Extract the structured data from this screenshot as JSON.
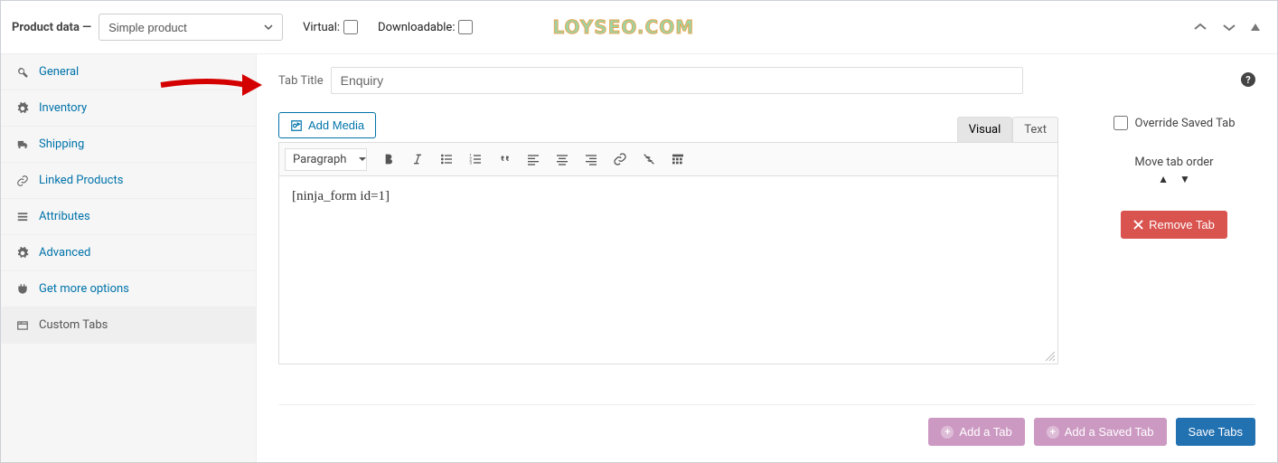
{
  "header": {
    "title": "Product data —",
    "product_type": "Simple product",
    "virtual_label": "Virtual:",
    "downloadable_label": "Downloadable:",
    "watermark": "LOYSEO.COM"
  },
  "sidebar": {
    "items": [
      {
        "icon": "wrench-icon",
        "label": "General"
      },
      {
        "icon": "gear-icon",
        "label": "Inventory"
      },
      {
        "icon": "truck-icon",
        "label": "Shipping"
      },
      {
        "icon": "link-icon",
        "label": "Linked Products"
      },
      {
        "icon": "list-icon",
        "label": "Attributes"
      },
      {
        "icon": "gear-icon",
        "label": "Advanced"
      },
      {
        "icon": "plugin-icon",
        "label": "Get more options"
      },
      {
        "icon": "tabs-icon",
        "label": "Custom Tabs"
      }
    ]
  },
  "custom_tab": {
    "tab_title_label": "Tab Title",
    "tab_title_value": "Enquiry",
    "add_media_label": "Add Media",
    "editor_tabs": {
      "visual": "Visual",
      "text": "Text"
    },
    "format_label": "Paragraph",
    "content": "[ninja_form id=1]",
    "override_label": "Override Saved Tab",
    "move_label": "Move tab order",
    "remove_label": "Remove Tab"
  },
  "footer": {
    "add_tab": "Add a Tab",
    "add_saved_tab": "Add a Saved Tab",
    "save_tabs": "Save Tabs"
  }
}
